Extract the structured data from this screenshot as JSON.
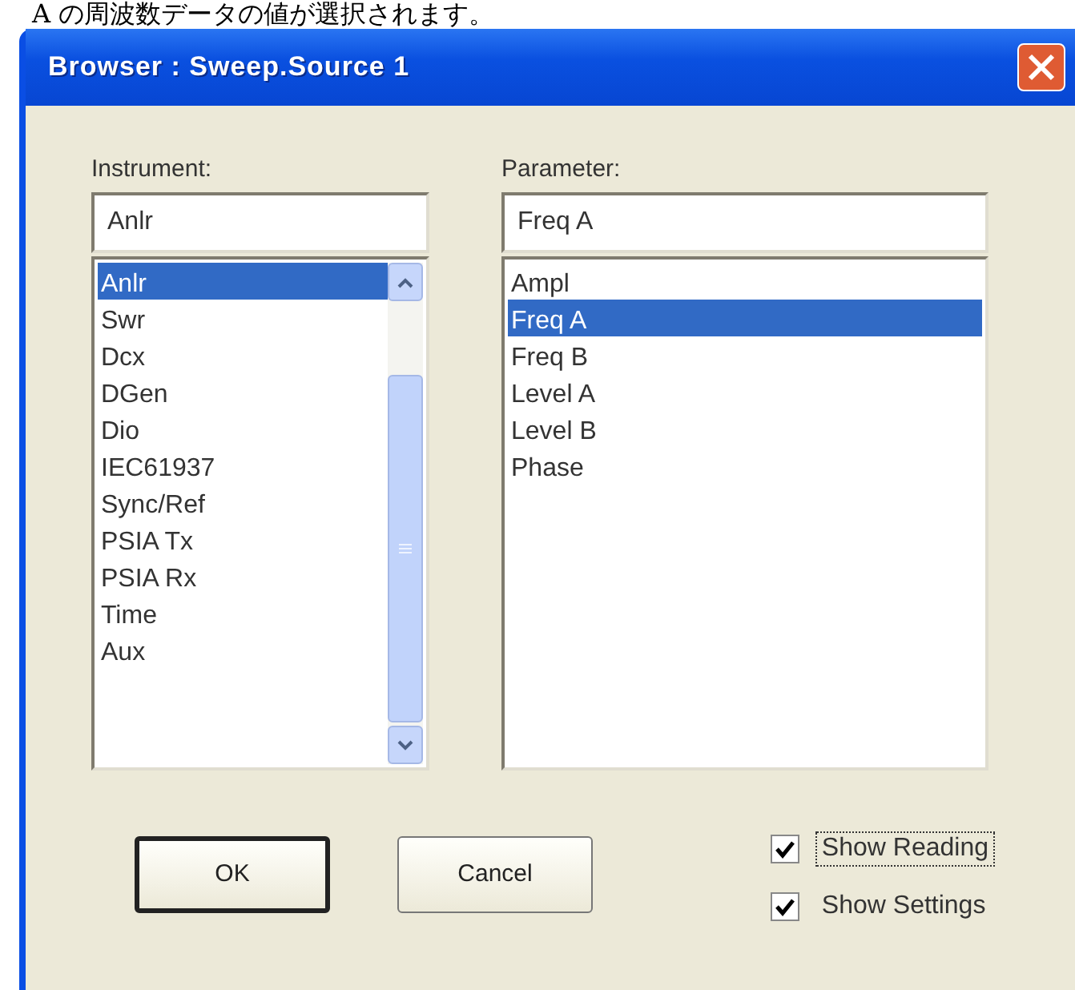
{
  "caption": "A の周波数データの値が選択されます。",
  "window": {
    "title": "Browser : Sweep.Source 1"
  },
  "instrument": {
    "label": "Instrument:",
    "value": "Anlr",
    "items": [
      {
        "label": "Anlr",
        "selected": true
      },
      {
        "label": "Swr",
        "selected": false
      },
      {
        "label": "Dcx",
        "selected": false
      },
      {
        "label": "DGen",
        "selected": false
      },
      {
        "label": "Dio",
        "selected": false
      },
      {
        "label": "IEC61937",
        "selected": false
      },
      {
        "label": "Sync/Ref",
        "selected": false
      },
      {
        "label": "PSIA Tx",
        "selected": false
      },
      {
        "label": "PSIA Rx",
        "selected": false
      },
      {
        "label": "Time",
        "selected": false
      },
      {
        "label": "Aux",
        "selected": false
      }
    ]
  },
  "parameter": {
    "label": "Parameter:",
    "value": "Freq A",
    "items": [
      {
        "label": "Ampl",
        "selected": false
      },
      {
        "label": "Freq A",
        "selected": true
      },
      {
        "label": "Freq B",
        "selected": false
      },
      {
        "label": "Level A",
        "selected": false
      },
      {
        "label": "Level B",
        "selected": false
      },
      {
        "label": "Phase",
        "selected": false
      }
    ]
  },
  "buttons": [
    {
      "label": "OK",
      "default": true
    },
    {
      "label": "Cancel",
      "default": false
    }
  ],
  "checkboxes": [
    {
      "label": "Show Reading",
      "checked": true,
      "focused": true
    },
    {
      "label": "Show Settings",
      "checked": true,
      "focused": false
    }
  ]
}
